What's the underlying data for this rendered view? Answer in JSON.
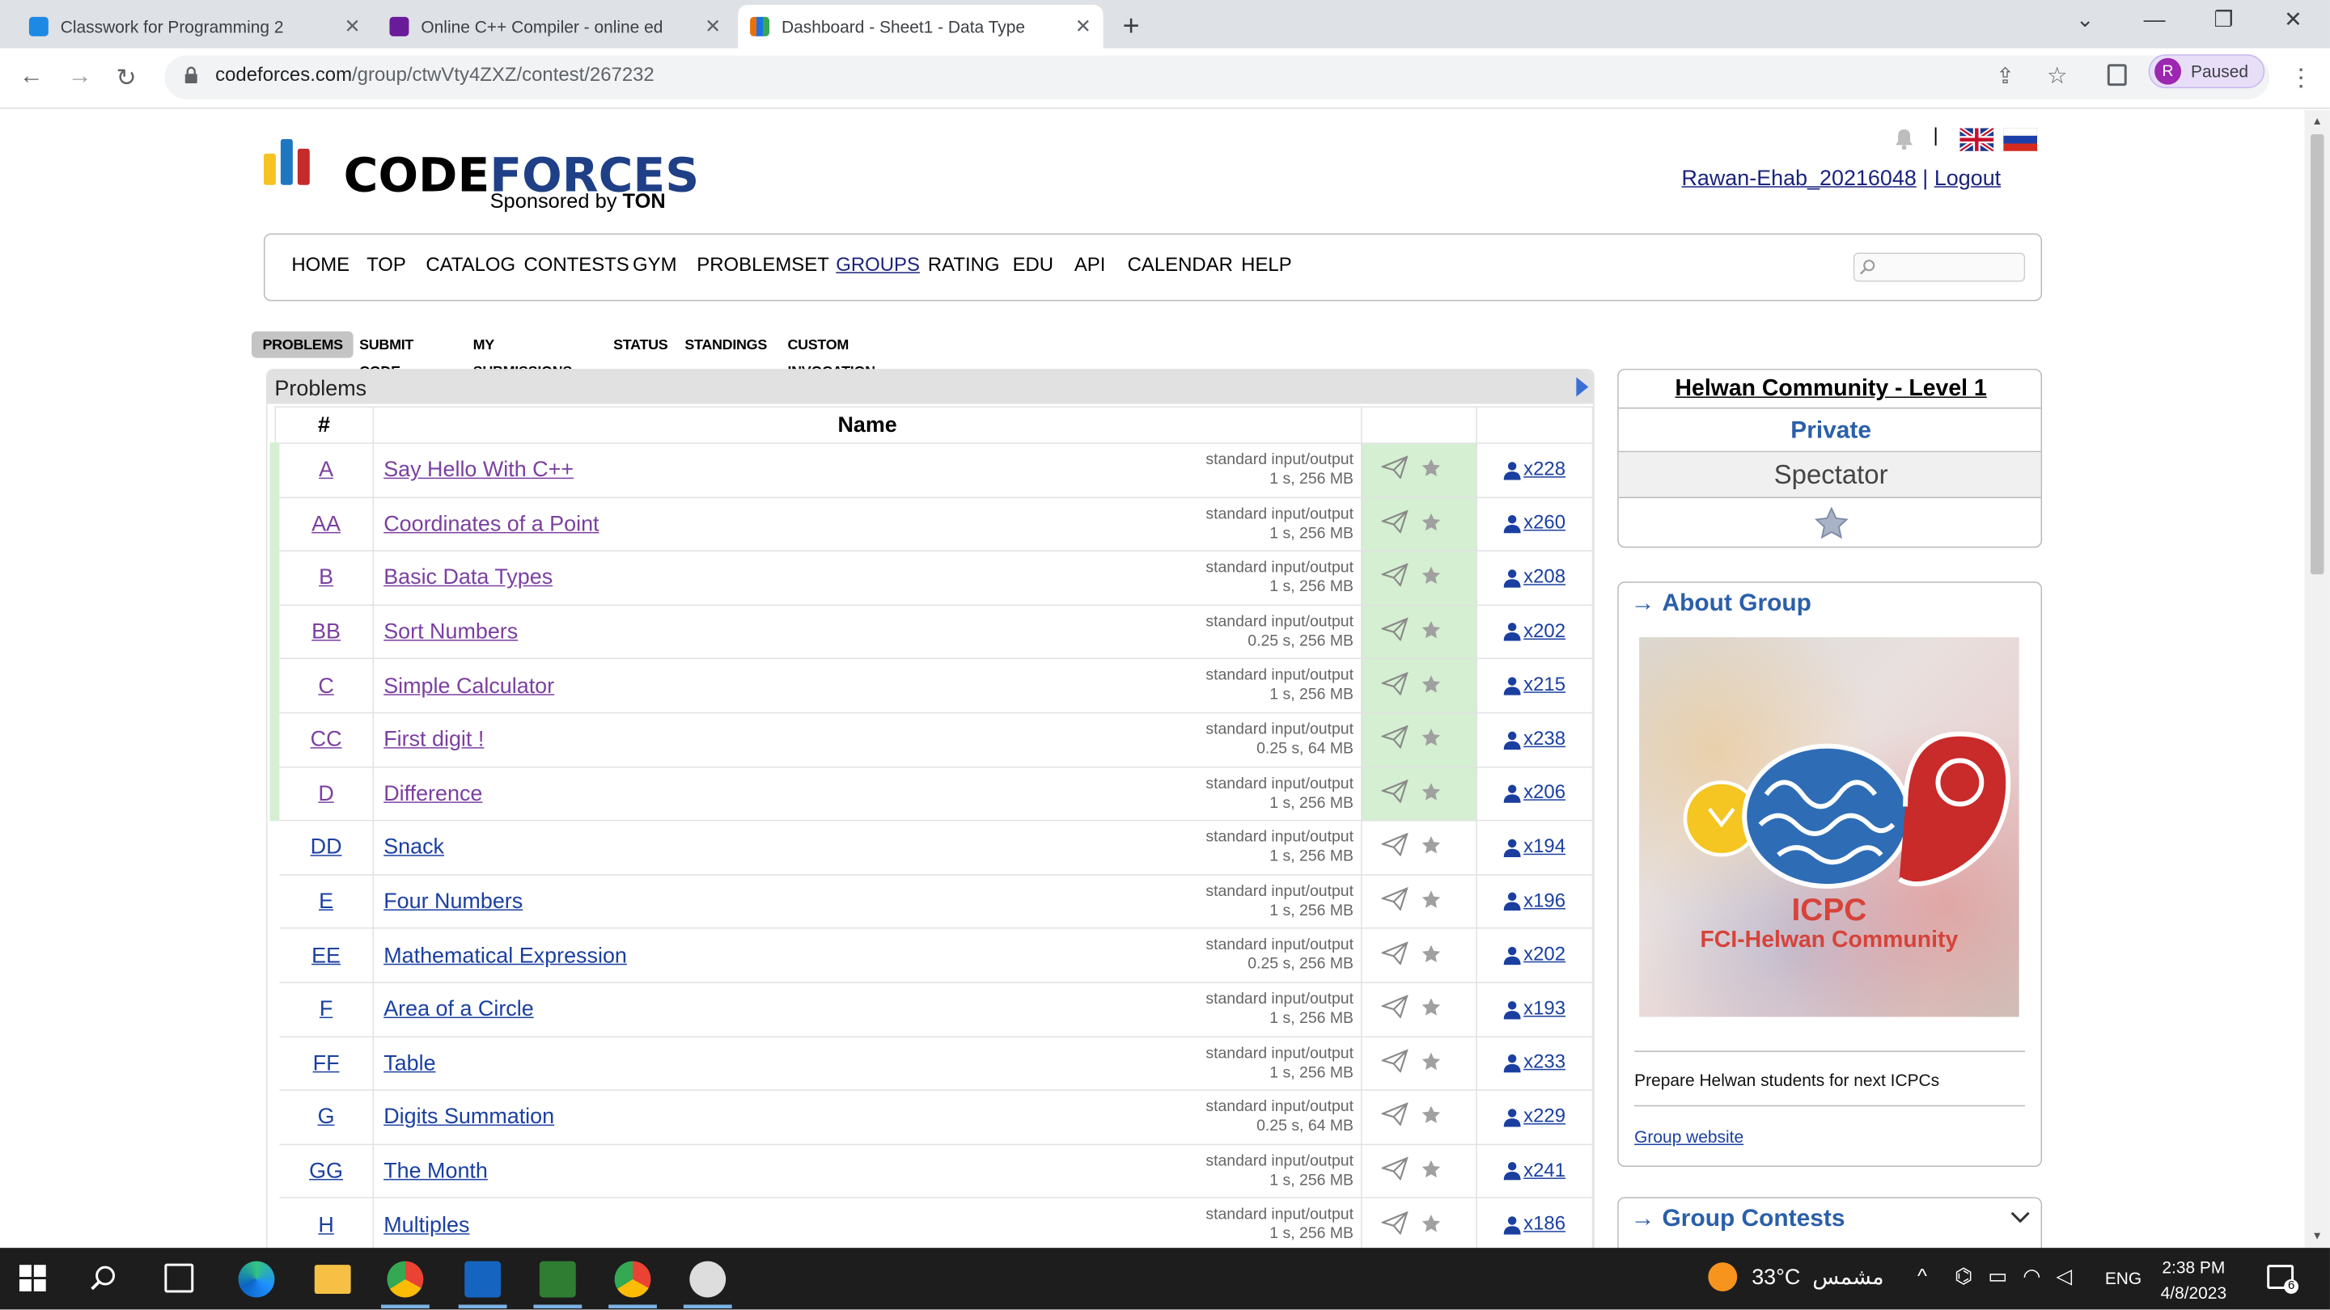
{
  "browser": {
    "tabs": [
      {
        "title": "Classwork for Programming 2",
        "icon": "google-classroom-icon",
        "color": "#1e8e3e"
      },
      {
        "title": "Online C++ Compiler - online ed",
        "icon": "compiler-icon",
        "color": "#6a1b9a"
      },
      {
        "title": "Dashboard - Sheet1 - Data Type",
        "icon": "tableau-icon",
        "color": "#e8710a"
      }
    ],
    "url_host": "codeforces.com",
    "url_path": "/group/ctwVty4ZXZ/contest/267232",
    "profile_initial": "R",
    "profile_status": "Paused"
  },
  "site": {
    "logo_part1": "CODE",
    "logo_part2": "FORCES",
    "sponsor_prefix": "Sponsored by",
    "sponsor_name": "TON",
    "username": "Rawan-Ehab_20216048",
    "logout": "Logout",
    "separator": "|",
    "menu": [
      "HOME",
      "TOP",
      "CATALOG",
      "CONTESTS",
      "GYM",
      "PROBLEMSET",
      "GROUPS",
      "RATING",
      "EDU",
      "API",
      "CALENDAR",
      "HELP"
    ],
    "menu_selected": "GROUPS",
    "submenu": [
      "PROBLEMS",
      "SUBMIT CODE",
      "MY SUBMISSIONS",
      "STATUS",
      "STANDINGS",
      "CUSTOM INVOCATION"
    ]
  },
  "problems": {
    "title": "Problems",
    "col_index": "#",
    "col_name": "Name",
    "rows": [
      {
        "id": "A",
        "name": "Say Hello With C++",
        "io": "standard input/output",
        "limits": "1 s, 256 MB",
        "solved": "x228",
        "accepted": true
      },
      {
        "id": "AA",
        "name": "Coordinates of a Point",
        "io": "standard input/output",
        "limits": "1 s, 256 MB",
        "solved": "x260",
        "accepted": true
      },
      {
        "id": "B",
        "name": "Basic Data Types",
        "io": "standard input/output",
        "limits": "1 s, 256 MB",
        "solved": "x208",
        "accepted": true
      },
      {
        "id": "BB",
        "name": "Sort Numbers",
        "io": "standard input/output",
        "limits": "0.25 s, 256 MB",
        "solved": "x202",
        "accepted": true
      },
      {
        "id": "C",
        "name": "Simple Calculator",
        "io": "standard input/output",
        "limits": "1 s, 256 MB",
        "solved": "x215",
        "accepted": true
      },
      {
        "id": "CC",
        "name": "First digit !",
        "io": "standard input/output",
        "limits": "0.25 s, 64 MB",
        "solved": "x238",
        "accepted": true
      },
      {
        "id": "D",
        "name": "Difference",
        "io": "standard input/output",
        "limits": "1 s, 256 MB",
        "solved": "x206",
        "accepted": true
      },
      {
        "id": "DD",
        "name": "Snack",
        "io": "standard input/output",
        "limits": "1 s, 256 MB",
        "solved": "x194",
        "accepted": false
      },
      {
        "id": "E",
        "name": "Four Numbers",
        "io": "standard input/output",
        "limits": "1 s, 256 MB",
        "solved": "x196",
        "accepted": false
      },
      {
        "id": "EE",
        "name": "Mathematical Expression",
        "io": "standard input/output",
        "limits": "0.25 s, 256 MB",
        "solved": "x202",
        "accepted": false
      },
      {
        "id": "F",
        "name": "Area of a Circle",
        "io": "standard input/output",
        "limits": "1 s, 256 MB",
        "solved": "x193",
        "accepted": false
      },
      {
        "id": "FF",
        "name": "Table",
        "io": "standard input/output",
        "limits": "1 s, 256 MB",
        "solved": "x233",
        "accepted": false
      },
      {
        "id": "G",
        "name": "Digits Summation",
        "io": "standard input/output",
        "limits": "0.25 s, 64 MB",
        "solved": "x229",
        "accepted": false
      },
      {
        "id": "GG",
        "name": "The Month",
        "io": "standard input/output",
        "limits": "1 s, 256 MB",
        "solved": "x241",
        "accepted": false
      },
      {
        "id": "H",
        "name": "Multiples",
        "io": "standard input/output",
        "limits": "1 s, 256 MB",
        "solved": "x186",
        "accepted": false
      }
    ]
  },
  "sidebar": {
    "group_name": "Helwan Community - Level 1",
    "visibility": "Private",
    "role": "Spectator",
    "about_title": "About Group",
    "image_line1": "ICPC",
    "image_line2": "FCI-Helwan Community",
    "description": "Prepare Helwan students for next ICPCs",
    "website_link": "Group website",
    "contests_title": "Group Contests"
  },
  "taskbar": {
    "temperature": "33°C",
    "weather_text": "مشمس",
    "language": "ENG",
    "time": "2:38 PM",
    "date": "4/8/2023",
    "notifications": "6"
  },
  "colors": {
    "accepted_row": "#d4efd1",
    "link_blue": "#1a3fa0",
    "visited_purple": "#7b3fa0",
    "brand_blue": "#1f3f86"
  }
}
